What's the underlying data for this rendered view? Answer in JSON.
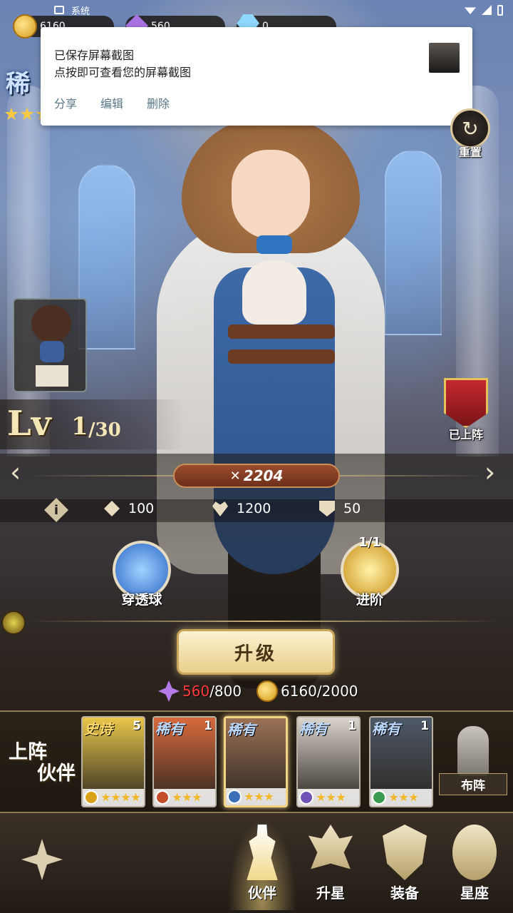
{
  "status_bar": {
    "app_label": "系统"
  },
  "resources": {
    "gold": "6160",
    "crystal": "560",
    "gems": "0"
  },
  "notification": {
    "title": "已保存屏幕截图",
    "body": "点按即可查看您的屏幕截图",
    "actions": [
      "分享",
      "编辑",
      "删除"
    ]
  },
  "rarity_banner": "稀",
  "reset_label": "重置",
  "level": {
    "prefix": "Lv",
    "current": "1",
    "max": "/30"
  },
  "deployed_label": "已上阵",
  "power": "2204",
  "stats": {
    "attack": "100",
    "hp": "1200",
    "defense": "50"
  },
  "skills": [
    {
      "name": "穿透球"
    },
    {
      "name": "进阶",
      "count": "1/1"
    }
  ],
  "upgrade_label": "升级",
  "cost": {
    "crystal_have": "560",
    "crystal_need": "/800",
    "gold": "6160/2000"
  },
  "team": {
    "label_line1": "上阵",
    "label_line2": "伙伴",
    "cards": [
      {
        "rarity": "史诗",
        "count": "5",
        "stars": 4,
        "color": "#e9c74a",
        "elem_color": "#d9a21b",
        "rar_color": "#ffd86a"
      },
      {
        "rarity": "稀有",
        "count": "1",
        "stars": 3,
        "color": "#d86a3c",
        "elem_color": "#c44e2a",
        "rar_color": "#bcd9ff"
      },
      {
        "rarity": "稀有",
        "count": "",
        "stars": 3,
        "color": "#9b7155",
        "elem_color": "#3b6fb8",
        "rar_color": "#bcd9ff"
      },
      {
        "rarity": "稀有",
        "count": "1",
        "stars": 3,
        "color": "#d9d4cc",
        "elem_color": "#6f52b8",
        "rar_color": "#bcd9ff"
      },
      {
        "rarity": "稀有",
        "count": "1",
        "stars": 3,
        "color": "#4e5968",
        "elem_color": "#3a9a4f",
        "rar_color": "#bcd9ff"
      }
    ],
    "formation_label": "布阵"
  },
  "nav": [
    {
      "label": "伙伴",
      "icon": "partner-icon",
      "active": true
    },
    {
      "label": "升星",
      "icon": "star-up-icon",
      "active": false
    },
    {
      "label": "装备",
      "icon": "equipment-icon",
      "active": false
    },
    {
      "label": "星座",
      "icon": "zodiac-icon",
      "active": false
    }
  ]
}
